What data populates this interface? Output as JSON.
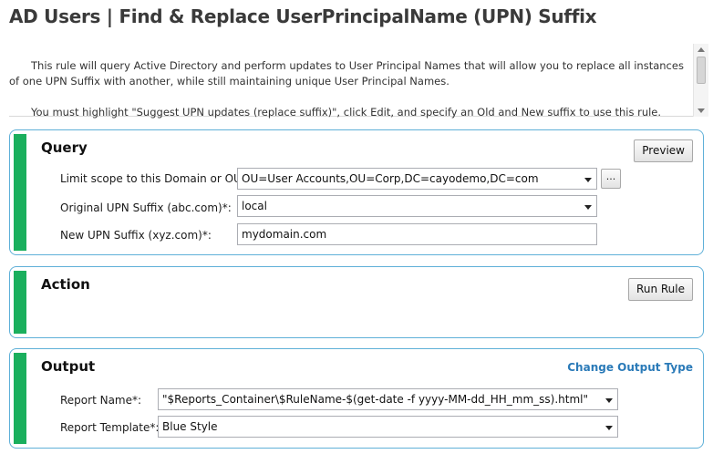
{
  "header": {
    "title": "AD Users | Find & Replace UserPrincipalName (UPN) Suffix"
  },
  "description": {
    "paragraph1": "This rule will query Active Directory and perform updates to User Principal Names that will allow you to replace all instances of one UPN Suffix with another, while still maintaining unique User Principal Names.",
    "paragraph2": "You must highlight \"Suggest UPN updates (replace suffix)\", click Edit, and specify an Old and New suffix to use this rule."
  },
  "query": {
    "title": "Query",
    "preview_label": "Preview",
    "scope_label": "Limit scope to this Domain or OU*:",
    "scope_value": "OU=User Accounts,OU=Corp,DC=cayodemo,DC=com",
    "browse_label": "...",
    "original_label": "Original UPN Suffix (abc.com)*:",
    "original_value": "local",
    "new_label": "New UPN Suffix (xyz.com)*:",
    "new_value": "mydomain.com"
  },
  "action": {
    "title": "Action",
    "run_label": "Run Rule"
  },
  "output": {
    "title": "Output",
    "change_type_label": "Change Output Type",
    "report_name_label": "Report Name*:",
    "report_name_value": "\"$Reports_Container\\$RuleName-$(get-date -f yyyy-MM-dd_HH_mm_ss).html\"",
    "template_label": "Report Template*:",
    "template_value": "Blue Style"
  },
  "colors": {
    "accent_green": "#1aaf5d",
    "section_border": "#5fb0d8",
    "link": "#2a7ab8"
  }
}
